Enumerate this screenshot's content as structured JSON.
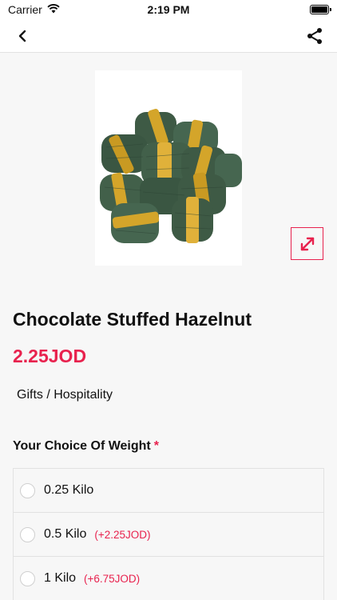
{
  "status": {
    "carrier": "Carrier",
    "time": "2:19 PM"
  },
  "icons": {
    "back": "chevron-left-icon",
    "share": "share-icon",
    "expand": "expand-arrows-icon",
    "wifi": "wifi-icon",
    "battery": "battery-icon"
  },
  "product": {
    "title": "Chocolate Stuffed Hazelnut",
    "price": "2.25JOD",
    "category": "Gifts / Hospitality"
  },
  "choice": {
    "label": "Your Choice Of Weight",
    "required_marker": "*",
    "options": [
      {
        "label": "0.25 Kilo",
        "extra": ""
      },
      {
        "label": "0.5 Kilo",
        "extra": "(+2.25JOD)"
      },
      {
        "label": "1 Kilo",
        "extra": "(+6.75JOD)"
      }
    ]
  },
  "colors": {
    "accent": "#e8224e",
    "background": "#f7f7f7",
    "chocolate_wrapper": "#3e5a45",
    "gold_band": "#d4a52a"
  }
}
